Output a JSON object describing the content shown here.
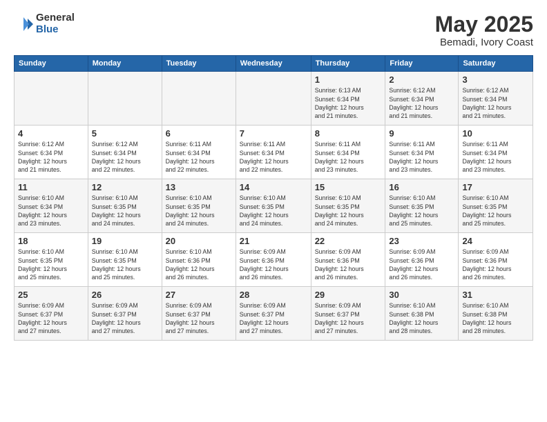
{
  "logo": {
    "general": "General",
    "blue": "Blue"
  },
  "title": "May 2025",
  "subtitle": "Bemadi, Ivory Coast",
  "days_of_week": [
    "Sunday",
    "Monday",
    "Tuesday",
    "Wednesday",
    "Thursday",
    "Friday",
    "Saturday"
  ],
  "weeks": [
    [
      {
        "num": "",
        "info": ""
      },
      {
        "num": "",
        "info": ""
      },
      {
        "num": "",
        "info": ""
      },
      {
        "num": "",
        "info": ""
      },
      {
        "num": "1",
        "info": "Sunrise: 6:13 AM\nSunset: 6:34 PM\nDaylight: 12 hours\nand 21 minutes."
      },
      {
        "num": "2",
        "info": "Sunrise: 6:12 AM\nSunset: 6:34 PM\nDaylight: 12 hours\nand 21 minutes."
      },
      {
        "num": "3",
        "info": "Sunrise: 6:12 AM\nSunset: 6:34 PM\nDaylight: 12 hours\nand 21 minutes."
      }
    ],
    [
      {
        "num": "4",
        "info": "Sunrise: 6:12 AM\nSunset: 6:34 PM\nDaylight: 12 hours\nand 21 minutes."
      },
      {
        "num": "5",
        "info": "Sunrise: 6:12 AM\nSunset: 6:34 PM\nDaylight: 12 hours\nand 22 minutes."
      },
      {
        "num": "6",
        "info": "Sunrise: 6:11 AM\nSunset: 6:34 PM\nDaylight: 12 hours\nand 22 minutes."
      },
      {
        "num": "7",
        "info": "Sunrise: 6:11 AM\nSunset: 6:34 PM\nDaylight: 12 hours\nand 22 minutes."
      },
      {
        "num": "8",
        "info": "Sunrise: 6:11 AM\nSunset: 6:34 PM\nDaylight: 12 hours\nand 23 minutes."
      },
      {
        "num": "9",
        "info": "Sunrise: 6:11 AM\nSunset: 6:34 PM\nDaylight: 12 hours\nand 23 minutes."
      },
      {
        "num": "10",
        "info": "Sunrise: 6:11 AM\nSunset: 6:34 PM\nDaylight: 12 hours\nand 23 minutes."
      }
    ],
    [
      {
        "num": "11",
        "info": "Sunrise: 6:10 AM\nSunset: 6:34 PM\nDaylight: 12 hours\nand 23 minutes."
      },
      {
        "num": "12",
        "info": "Sunrise: 6:10 AM\nSunset: 6:35 PM\nDaylight: 12 hours\nand 24 minutes."
      },
      {
        "num": "13",
        "info": "Sunrise: 6:10 AM\nSunset: 6:35 PM\nDaylight: 12 hours\nand 24 minutes."
      },
      {
        "num": "14",
        "info": "Sunrise: 6:10 AM\nSunset: 6:35 PM\nDaylight: 12 hours\nand 24 minutes."
      },
      {
        "num": "15",
        "info": "Sunrise: 6:10 AM\nSunset: 6:35 PM\nDaylight: 12 hours\nand 24 minutes."
      },
      {
        "num": "16",
        "info": "Sunrise: 6:10 AM\nSunset: 6:35 PM\nDaylight: 12 hours\nand 25 minutes."
      },
      {
        "num": "17",
        "info": "Sunrise: 6:10 AM\nSunset: 6:35 PM\nDaylight: 12 hours\nand 25 minutes."
      }
    ],
    [
      {
        "num": "18",
        "info": "Sunrise: 6:10 AM\nSunset: 6:35 PM\nDaylight: 12 hours\nand 25 minutes."
      },
      {
        "num": "19",
        "info": "Sunrise: 6:10 AM\nSunset: 6:35 PM\nDaylight: 12 hours\nand 25 minutes."
      },
      {
        "num": "20",
        "info": "Sunrise: 6:10 AM\nSunset: 6:36 PM\nDaylight: 12 hours\nand 26 minutes."
      },
      {
        "num": "21",
        "info": "Sunrise: 6:09 AM\nSunset: 6:36 PM\nDaylight: 12 hours\nand 26 minutes."
      },
      {
        "num": "22",
        "info": "Sunrise: 6:09 AM\nSunset: 6:36 PM\nDaylight: 12 hours\nand 26 minutes."
      },
      {
        "num": "23",
        "info": "Sunrise: 6:09 AM\nSunset: 6:36 PM\nDaylight: 12 hours\nand 26 minutes."
      },
      {
        "num": "24",
        "info": "Sunrise: 6:09 AM\nSunset: 6:36 PM\nDaylight: 12 hours\nand 26 minutes."
      }
    ],
    [
      {
        "num": "25",
        "info": "Sunrise: 6:09 AM\nSunset: 6:37 PM\nDaylight: 12 hours\nand 27 minutes."
      },
      {
        "num": "26",
        "info": "Sunrise: 6:09 AM\nSunset: 6:37 PM\nDaylight: 12 hours\nand 27 minutes."
      },
      {
        "num": "27",
        "info": "Sunrise: 6:09 AM\nSunset: 6:37 PM\nDaylight: 12 hours\nand 27 minutes."
      },
      {
        "num": "28",
        "info": "Sunrise: 6:09 AM\nSunset: 6:37 PM\nDaylight: 12 hours\nand 27 minutes."
      },
      {
        "num": "29",
        "info": "Sunrise: 6:09 AM\nSunset: 6:37 PM\nDaylight: 12 hours\nand 27 minutes."
      },
      {
        "num": "30",
        "info": "Sunrise: 6:10 AM\nSunset: 6:38 PM\nDaylight: 12 hours\nand 28 minutes."
      },
      {
        "num": "31",
        "info": "Sunrise: 6:10 AM\nSunset: 6:38 PM\nDaylight: 12 hours\nand 28 minutes."
      }
    ]
  ]
}
